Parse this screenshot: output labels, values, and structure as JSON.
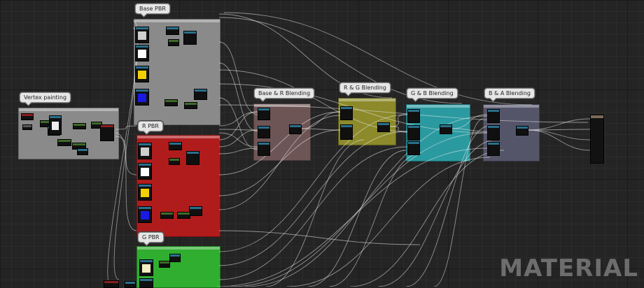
{
  "comments": {
    "base_pbr": "Base PBR",
    "vertex_painting": "Vertex painting",
    "r_pbr": "R PBR",
    "g_pbr": "G PBR",
    "base_r_blending": "Base & R Blending",
    "r_g_blending": "R & G Blending",
    "g_b_blending": "G & B Blending",
    "b_a_blending": "B & A Blending"
  },
  "watermark": "MATERIAL",
  "colors": {
    "base_box": "#8a8a8a",
    "r_box": "#b01c1c",
    "g_box": "#2fae2f",
    "base_r_box": "#6e5555",
    "r_g_box": "#8c8a2a",
    "g_b_box": "#2a9aa0",
    "b_a_box": "#55556a",
    "vertex_box": "#8a8a8a"
  }
}
